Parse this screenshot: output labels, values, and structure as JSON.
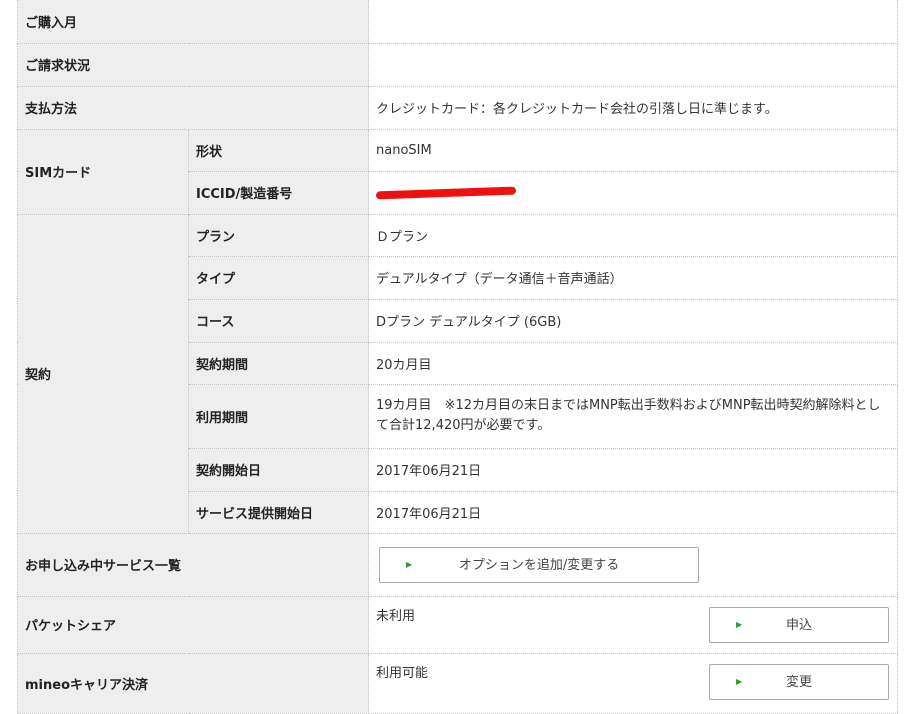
{
  "rows": {
    "purchase_month": {
      "label": "ご購入月",
      "value": ""
    },
    "billing_status": {
      "label": "ご請求状況",
      "value": ""
    },
    "payment_method": {
      "label": "支払方法",
      "value": "クレジットカード：各クレジットカード会社の引落し日に準じます。"
    },
    "sim_card": {
      "label": "SIMカード",
      "shape_label": "形状",
      "shape_value": "nanoSIM",
      "iccid_label": "ICCID/製造番号"
    },
    "contract": {
      "label": "契約",
      "plan_label": "プラン",
      "plan_value": "Ｄプラン",
      "type_label": "タイプ",
      "type_value": "デュアルタイプ（データ通信＋音声通話）",
      "course_label": "コース",
      "course_value": "Dプラン デュアルタイプ (6GB)",
      "period_label": "契約期間",
      "period_value": "20カ月目",
      "usage_label": "利用期間",
      "usage_value": "19カ月目　※12カ月目の末日まではMNP転出手数料およびMNP転出時契約解除料として合計12,420円が必要です。",
      "start_label": "契約開始日",
      "start_value": "2017年06月21日",
      "service_start_label": "サービス提供開始日",
      "service_start_value": "2017年06月21日"
    },
    "services": {
      "label": "お申し込み中サービス一覧",
      "button": "オプションを追加/変更する"
    },
    "packet_share": {
      "label": "パケットシェア",
      "value": "未利用",
      "button": "申込"
    },
    "carrier_billing": {
      "label": "mineoキャリア決済",
      "value": "利用可能",
      "button": "変更"
    }
  },
  "colors": {
    "header_bg": "#eeeeee",
    "arrow": "#2e9c34",
    "redaction": "#ee1111"
  },
  "icons": {
    "button_arrow": "triangle-right-icon"
  }
}
